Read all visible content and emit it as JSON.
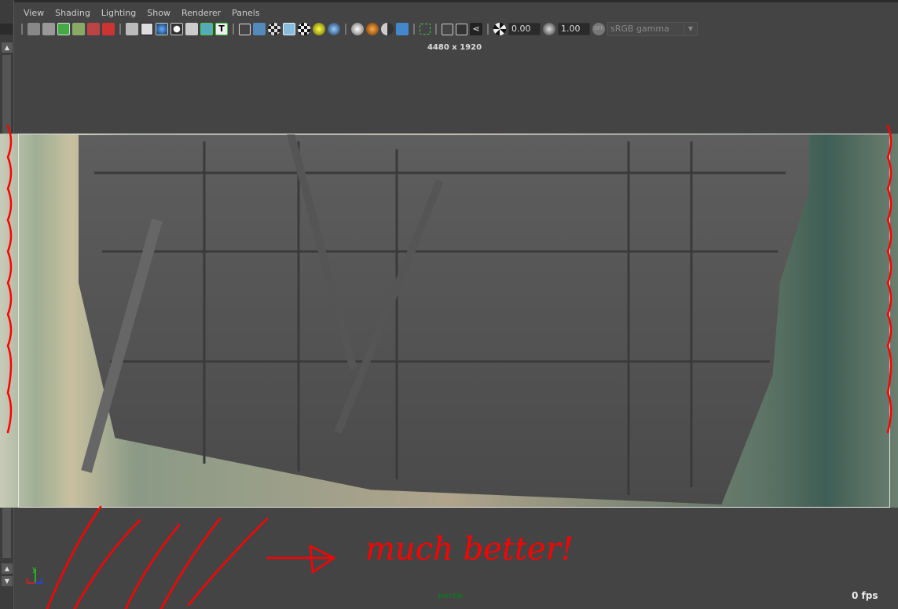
{
  "menu": [
    "View",
    "Shading",
    "Lighting",
    "Show",
    "Renderer",
    "Panels"
  ],
  "toolbar": {
    "icons": [
      "select-camera-icon",
      "camera-attributes-icon",
      "bookmarks-icon",
      "image-plane-icon",
      "2d-pan-zoom-icon",
      "grease-pencil-icon",
      "grid-icon",
      "film-gate-icon",
      "resolution-gate-icon",
      "gate-mask-icon",
      "field-chart-icon",
      "safe-action-icon",
      "safe-title-icon",
      "wireframe-icon",
      "smooth-shade-icon",
      "default-material-icon",
      "textured-icon",
      "wireframe-on-shaded-icon",
      "use-all-lights-icon",
      "shadows-icon",
      "screen-space-ao-icon",
      "motion-blur-icon",
      "multisample-aa-icon",
      "depth-of-field-icon",
      "isolate-select-icon",
      "xray-icon",
      "xray-active-components-icon",
      "xray-joints-icon",
      "exposure-icon",
      "gamma-icon",
      "color-management-toggle-icon"
    ],
    "exposure": "0.00",
    "gamma": "1.00",
    "color_space": "sRGB gamma"
  },
  "resolution": "4480 x 1920",
  "annotation": "much better!",
  "axis": {
    "x": "x",
    "y": "y",
    "z": "z"
  },
  "camera": "persp",
  "fps": "0 fps",
  "colors": {
    "annotation": "#ff0000",
    "axis_x": "#e02020",
    "axis_y": "#20d020",
    "axis_z": "#2040ff"
  }
}
